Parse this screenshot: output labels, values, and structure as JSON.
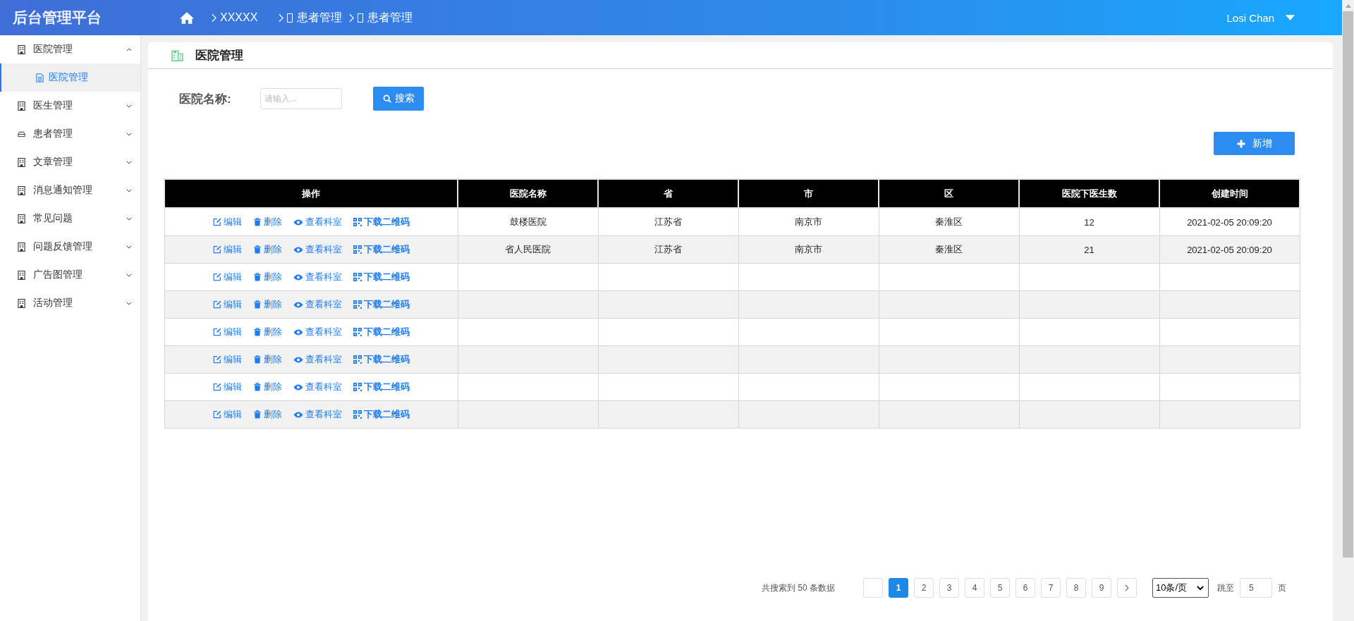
{
  "header": {
    "title": "后台管理平台",
    "breadcrumb": [
      {
        "label": "XXXXX",
        "glyph": false
      },
      {
        "label": "患者管理",
        "glyph": true
      },
      {
        "label": "患者管理",
        "glyph": true
      }
    ],
    "user": "Losi Chan"
  },
  "sidebar": {
    "items": [
      {
        "label": "医院管理",
        "kind": "building",
        "expanded": true,
        "children": [
          {
            "label": "医院管理",
            "selected": true
          }
        ]
      },
      {
        "label": "医生管理",
        "kind": "building",
        "expanded": false
      },
      {
        "label": "患者管理",
        "kind": "tray",
        "expanded": false
      },
      {
        "label": "文章管理",
        "kind": "building",
        "expanded": false
      },
      {
        "label": "消息通知管理",
        "kind": "building",
        "expanded": false
      },
      {
        "label": "常见问题",
        "kind": "building",
        "expanded": false
      },
      {
        "label": "问题反馈管理",
        "kind": "building",
        "expanded": false
      },
      {
        "label": "广告图管理",
        "kind": "building",
        "expanded": false
      },
      {
        "label": "活动管理",
        "kind": "building",
        "expanded": false
      }
    ]
  },
  "page": {
    "title": "医院管理"
  },
  "filter": {
    "label": "医院名称:",
    "placeholder": "请输入...",
    "search_button": "搜索"
  },
  "add_button": "新增",
  "table": {
    "columns": [
      "操作",
      "医院名称",
      "省",
      "市",
      "区",
      "医院下医生数",
      "创建时间"
    ],
    "rows": [
      {
        "actions": [
          {
            "kind": "edit",
            "label": "编辑"
          },
          {
            "kind": "delete",
            "label": "删除"
          },
          {
            "kind": "view",
            "label": "查看科室"
          },
          {
            "kind": "qrcode",
            "label": "下载二维码"
          }
        ],
        "cells": [
          "鼓楼医院",
          "江苏省",
          "南京市",
          "秦淮区",
          "12",
          "2021-02-05 20:09:20"
        ]
      },
      {
        "actions": [
          {
            "kind": "edit",
            "label": "编辑"
          },
          {
            "kind": "delete",
            "label": "删除"
          },
          {
            "kind": "view",
            "label": "查看科室"
          },
          {
            "kind": "qrcode",
            "label": "下载二维码"
          }
        ],
        "cells": [
          "省人民医院",
          "江苏省",
          "南京市",
          "秦淮区",
          "21",
          "2021-02-05 20:09:20"
        ]
      },
      {
        "actions": [
          {
            "kind": "edit",
            "label": "编辑"
          },
          {
            "kind": "delete",
            "label": "删除"
          },
          {
            "kind": "view",
            "label": "查看科室"
          },
          {
            "kind": "qrcode",
            "label": "下载二维码"
          }
        ]
      },
      {
        "actions": [
          {
            "kind": "edit",
            "label": "编辑"
          },
          {
            "kind": "delete",
            "label": "删除"
          },
          {
            "kind": "view",
            "label": "查看科室"
          },
          {
            "kind": "qrcode",
            "label": "下载二维码"
          }
        ]
      },
      {
        "actions": [
          {
            "kind": "edit",
            "label": "编辑"
          },
          {
            "kind": "delete",
            "label": "删除"
          },
          {
            "kind": "view",
            "label": "查看科室"
          },
          {
            "kind": "qrcode",
            "label": "下载二维码"
          }
        ]
      },
      {
        "actions": [
          {
            "kind": "edit",
            "label": "编辑"
          },
          {
            "kind": "delete",
            "label": "删除"
          },
          {
            "kind": "view",
            "label": "查看科室"
          },
          {
            "kind": "qrcode",
            "label": "下载二维码"
          }
        ]
      },
      {
        "actions": [
          {
            "kind": "edit",
            "label": "编辑"
          },
          {
            "kind": "delete",
            "label": "删除"
          },
          {
            "kind": "view",
            "label": "查看科室"
          },
          {
            "kind": "qrcode",
            "label": "下载二维码"
          }
        ]
      },
      {
        "actions": [
          {
            "kind": "edit",
            "label": "编辑"
          },
          {
            "kind": "delete",
            "label": "删除"
          },
          {
            "kind": "view",
            "label": "查看科室"
          },
          {
            "kind": "qrcode",
            "label": "下载二维码"
          }
        ]
      }
    ]
  },
  "pagination": {
    "summary": "共搜索到 50 条数据",
    "pages": [
      {
        "label": "1",
        "selected": true
      },
      {
        "label": "2",
        "selected": false
      },
      {
        "label": "3",
        "selected": false
      },
      {
        "label": "4",
        "selected": false
      },
      {
        "label": "5",
        "selected": false
      },
      {
        "label": "6",
        "selected": false
      },
      {
        "label": "7",
        "selected": false
      },
      {
        "label": "8",
        "selected": false
      },
      {
        "label": "9",
        "selected": false
      }
    ],
    "page_size": "10条/页",
    "jump_label": "跳至",
    "jump_value": "5",
    "jump_unit": "页"
  }
}
